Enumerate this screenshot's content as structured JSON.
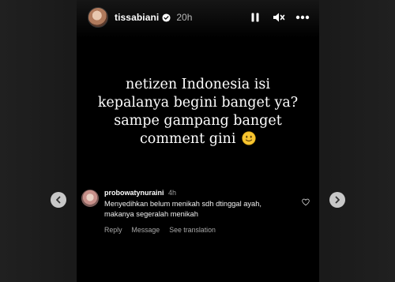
{
  "story": {
    "username": "tissabiani",
    "time": "20h",
    "text_lines": [
      "netizen Indonesia isi",
      "kepalanya begini banget ya?",
      "sampe gampang banget",
      "comment gini"
    ],
    "emoji": "slightly-smiling-face-icon"
  },
  "comment": {
    "username": "probowatynuraini",
    "time": "4h",
    "text_line1": "Menyedihkan belum menikah sdh dtinggal ayah,",
    "text_line2": "makanya segeralah menikah",
    "actions": {
      "reply": "Reply",
      "message": "Message",
      "translation": "See translation"
    }
  },
  "controls": {
    "pause": "pause-icon",
    "mute": "mute-icon",
    "more": "more-icon"
  },
  "colors": {
    "background": "#1c1c1c",
    "story_bg": "#000000",
    "nav_button": "#c8c8c8",
    "secondary_text": "#a8a8a8"
  }
}
